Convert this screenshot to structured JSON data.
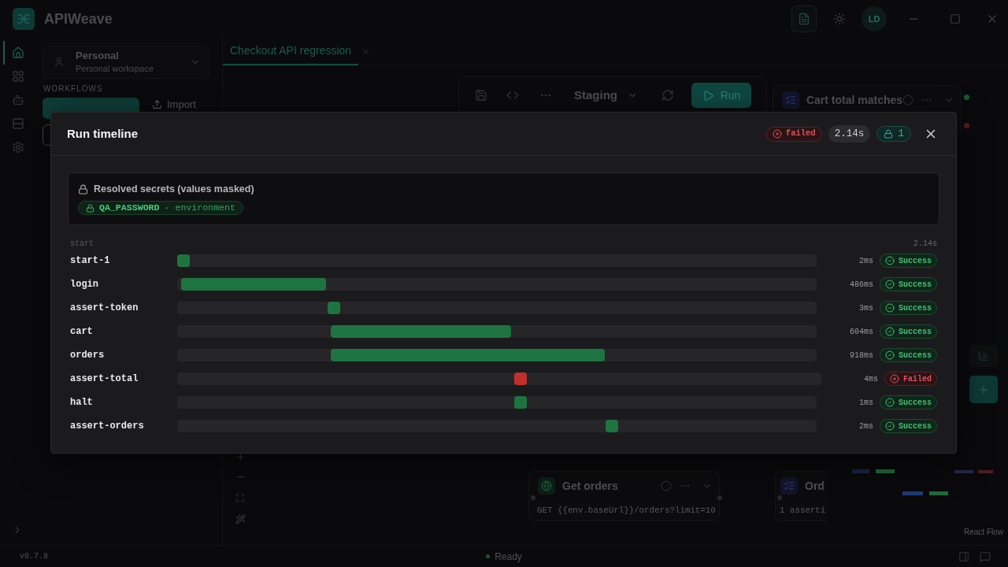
{
  "app": {
    "title": "APIWeave",
    "avatar": "LD"
  },
  "nav_rail": [
    {
      "selected": true
    },
    {
      "selected": false
    },
    {
      "selected": false
    },
    {
      "selected": false
    },
    {
      "selected": false
    }
  ],
  "sidebar": {
    "workspace": {
      "name": "Personal",
      "subtitle": "Personal workspace"
    },
    "section_label": "WORKFLOWS",
    "import_button": "Import"
  },
  "tabs": [
    {
      "label": "Checkout API regression",
      "selected": true
    }
  ],
  "toolbar": {
    "environment": "Staging",
    "run_button": "Run"
  },
  "canvas": {
    "nodes": [
      {
        "kind": "assertion",
        "title": "Cart total matches"
      },
      {
        "kind": "request",
        "title": "Get orders",
        "detail": "GET {{env.baseUrl}}/orders?limit=10"
      },
      {
        "kind": "assertion",
        "title": "Ord",
        "detail": "1 asserti"
      }
    ],
    "attribution": "React Flow"
  },
  "status_bar": {
    "version": "v0.7.8",
    "status": "Ready"
  },
  "modal": {
    "title": "Run timeline",
    "status": {
      "kind": "failed",
      "label": "failed"
    },
    "duration": "2.14s",
    "secret_count": "1",
    "secrets": {
      "heading": "Resolved secrets (values masked)",
      "items": [
        {
          "name": "QA_PASSWORD",
          "detail": "· environment"
        }
      ]
    },
    "timeline": {
      "start_label": "start",
      "end_label": "2.14s",
      "rows": [
        {
          "name": "start-1",
          "duration": "2ms",
          "status": {
            "kind": "success",
            "label": "Success"
          }
        },
        {
          "name": "login",
          "duration": "486ms",
          "status": {
            "kind": "success",
            "label": "Success"
          }
        },
        {
          "name": "assert-token",
          "duration": "3ms",
          "status": {
            "kind": "success",
            "label": "Success"
          }
        },
        {
          "name": "cart",
          "duration": "604ms",
          "status": {
            "kind": "success",
            "label": "Success"
          }
        },
        {
          "name": "orders",
          "duration": "918ms",
          "status": {
            "kind": "success",
            "label": "Success"
          }
        },
        {
          "name": "assert-total",
          "duration": "4ms",
          "status": {
            "kind": "failed",
            "label": "Failed"
          }
        },
        {
          "name": "halt",
          "duration": "1ms",
          "status": {
            "kind": "success",
            "label": "Success"
          }
        },
        {
          "name": "assert-orders",
          "duration": "2ms",
          "status": {
            "kind": "success",
            "label": "Success"
          }
        }
      ]
    }
  }
}
